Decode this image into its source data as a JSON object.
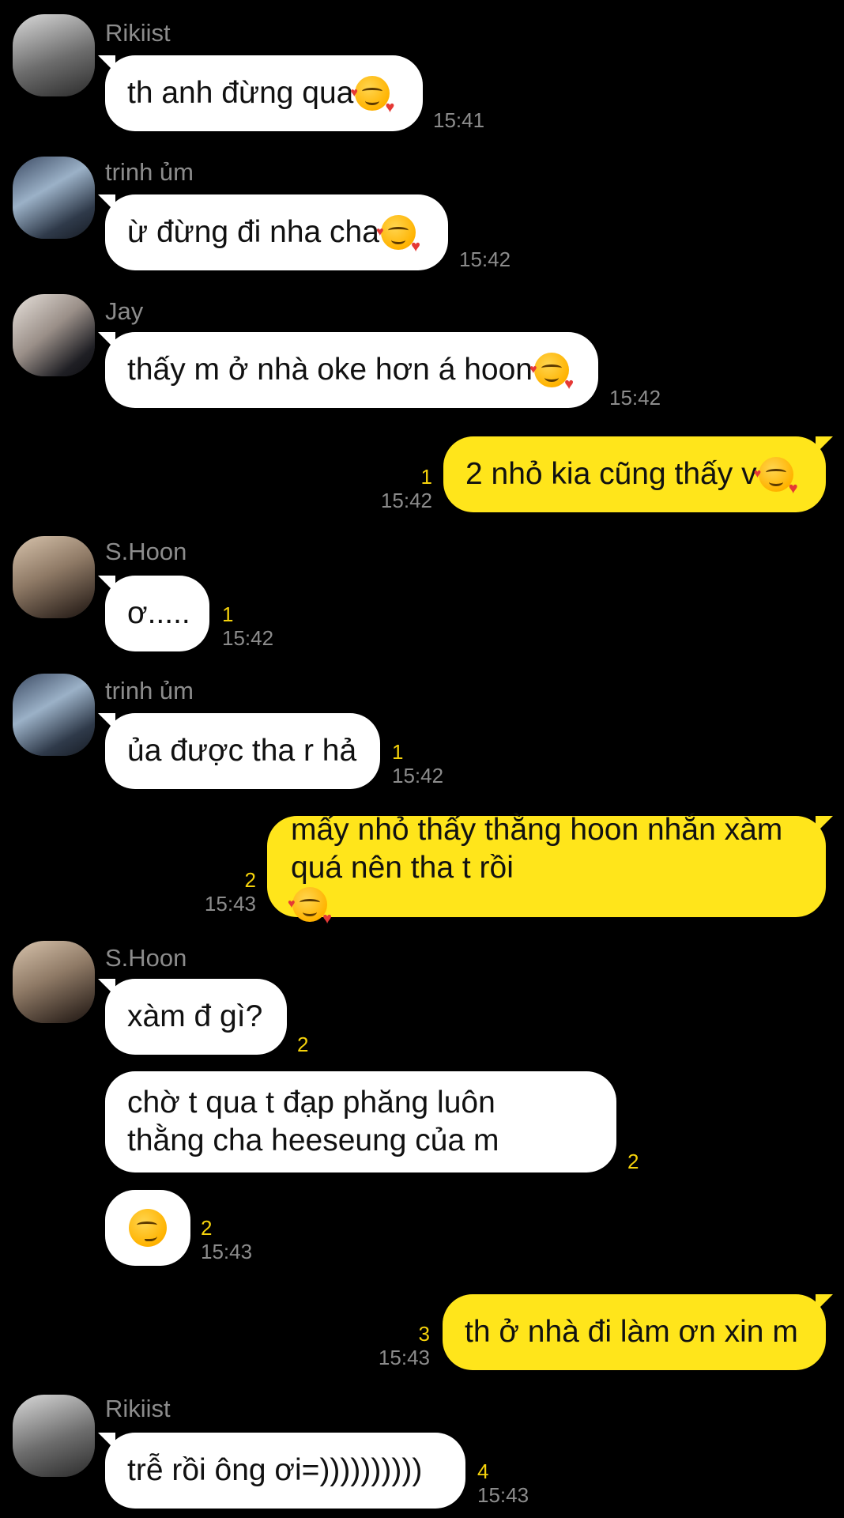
{
  "colors": {
    "background": "#000000",
    "incoming_bubble": "#ffffff",
    "outgoing_bubble": "#ffe51b",
    "read_count": "#f5d20b",
    "meta_text": "#8c8c8c"
  },
  "messages": [
    {
      "sender": "Rikiist",
      "text": "th anh đừng qua",
      "emoji": "smiling-face-with-hearts-emoji",
      "time": "15:41",
      "count": ""
    },
    {
      "sender": "trinh ủm",
      "text": "ừ đừng đi nha cha",
      "emoji": "smiling-face-with-hearts-emoji",
      "time": "15:42",
      "count": ""
    },
    {
      "sender": "Jay",
      "text": "thấy m ở nhà oke hơn á hoon",
      "emoji": "smiling-face-with-hearts-emoji",
      "time": "15:42",
      "count": ""
    },
    {
      "sender": "",
      "text": "2 nhỏ kia cũng thấy v",
      "emoji": "smiling-face-with-hearts-emoji",
      "time": "15:42",
      "count": "1"
    },
    {
      "sender": "S.Hoon",
      "text": "ơ.....",
      "time": "15:42",
      "count": "1"
    },
    {
      "sender": "trinh ủm",
      "text": "ủa được tha r hả",
      "time": "15:42",
      "count": "1"
    },
    {
      "sender": "",
      "line1": "mấy nhỏ thấy thằng hoon nhắn xàm",
      "line2": "quá nên tha t rồi",
      "emoji": "smiling-face-with-hearts-emoji",
      "time": "15:43",
      "count": "2"
    },
    {
      "sender": "S.Hoon",
      "text": "xàm đ gì?",
      "count": "2"
    },
    {
      "sender": "",
      "line1": "chờ t qua t đạp phăng luôn",
      "line2": "thằng cha heeseung của m",
      "count": "2"
    },
    {
      "sender": "",
      "emoji": "smirking-face-emoji",
      "time": "15:43",
      "count": "2"
    },
    {
      "sender": "",
      "text": "th ở nhà đi làm ơn xin m",
      "time": "15:43",
      "count": "3"
    },
    {
      "sender": "Rikiist",
      "text": "trễ rồi ông ơi=))))))))))",
      "time": "15:43",
      "count": "4"
    }
  ]
}
